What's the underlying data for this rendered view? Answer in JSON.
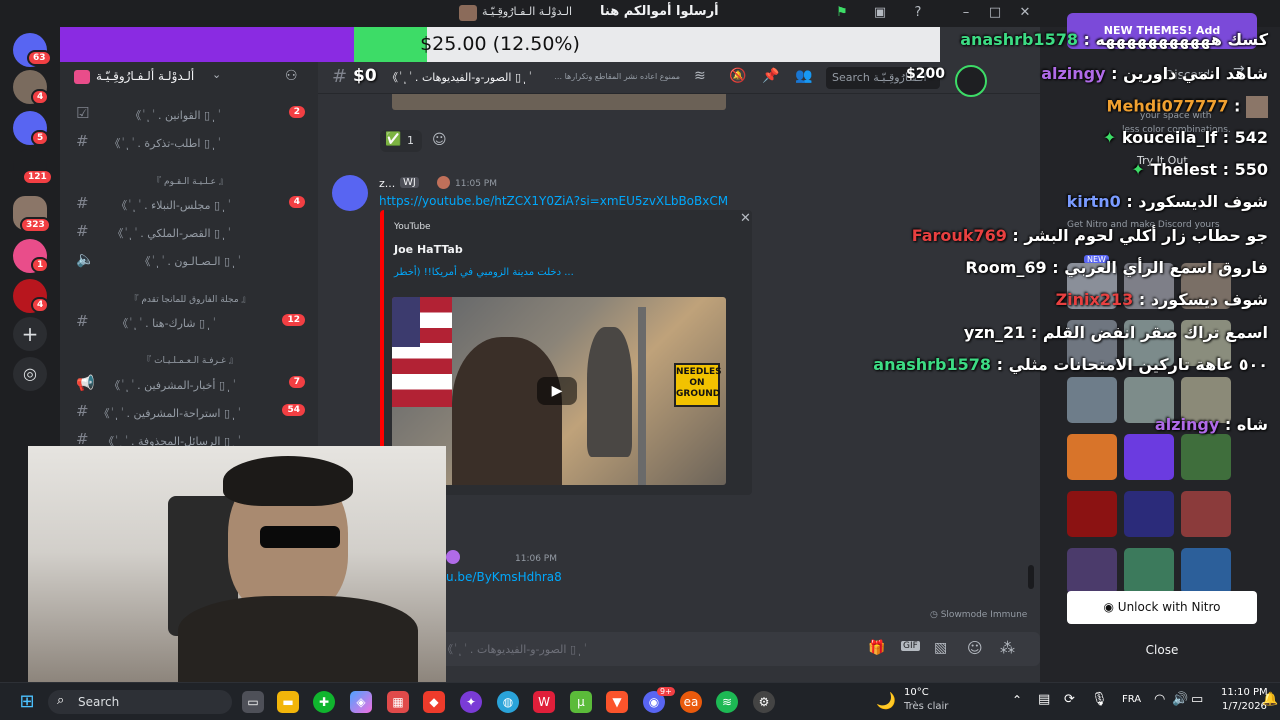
{
  "window": {
    "title": "أرسلوا أموالكم هنا",
    "server_name": "الـدوْلـة الـفـارُوقِـيّـة"
  },
  "goal_bar": {
    "text": "$25.00 (12.50%)",
    "progress_percent": 12.5,
    "left_amount": "$0",
    "right_amount": "$200"
  },
  "rail": {
    "badges": [
      "63",
      "4",
      "5",
      "121",
      "323",
      "1",
      "4"
    ]
  },
  "sidebar": {
    "server_title": "ألـدوْلـة ألـفـارُوقِـيّـة",
    "channels": [
      {
        "label": "《 ٰ ٖ ٰ . القوانين ▯ ٖ ٰ",
        "count": "2"
      },
      {
        "label": "《 ٰ ٖ ٰ . اطلب-تذكرة ▯ ٖ ٰ",
        "count": ""
      },
      {
        "label": "《 ٰ ٖ ٰ . مجلس-النبلاء ▯ ٖ ٰ",
        "count": "4"
      },
      {
        "label": "《 ٰ ٖ ٰ . القصر-الملكي ▯ ٖ ٰ",
        "count": ""
      },
      {
        "label": "《 ٰ ٖ ٰ . الـصـالـون ▯ ٖ ٰ",
        "count": ""
      },
      {
        "label": "《 ٰ ٖ ٰ . شارك-هنا ▯ ٖ ٰ",
        "count": "12"
      },
      {
        "label": "《 ٰ ٖ ٰ . أخبار-المشرفين ▯ ٖ ٰ",
        "count": "7"
      },
      {
        "label": "《 ٰ ٖ ٰ . استراحة-المشرفين ▯ ٖ ٰ",
        "count": "54"
      },
      {
        "label": "《 ٰ ٖ ٰ . الرسائل-المحذوفة ▯ ٖ ٰ",
        "count": ""
      }
    ],
    "categories": [
      "『 عـلـيـة الـقـوم 』",
      "『 مجلة الفاروق للمانجا تقدم 』",
      "『 غـرفـة الـعـمـلـيـات 』"
    ]
  },
  "header": {
    "channel_name": "《 ٰ ٖ ٰ . الصور-و-الفيديوهات ▯ ٖ ٰ",
    "topic": "ممنوع اعاده نشر المقاطع وتكرارها ...",
    "search_placeholder": "Search الـفـارُوقِـيّـة"
  },
  "messages": {
    "reaction_count": "1",
    "author": "z...",
    "author_tag": "WJ",
    "time": "11:05 PM",
    "link": "https://youtube.be/htZCX1Y0ZiA?si=xmEU5zvXLbBoBxCM",
    "embed_provider": "YouTube",
    "embed_author": "Joe HaTTab",
    "embed_title": "دخلت مدينة الزومبي في أمريكا!! (أخطر ...",
    "sign_text": "NEEDLES ON GROUND",
    "second_time": "11:06 PM",
    "second_link": "u.be/ByKmsHdhra8",
    "slowmode": "Slowmode Immune"
  },
  "input": {
    "placeholder": "《 ٰ ٖ ٰ . الصور-و-الفيديوهات ▯ ٖ ٰ"
  },
  "overlay_chat": [
    {
      "user": "anashrb1578",
      "text": "كسك هههههههههههه",
      "color": "#3ddc84"
    },
    {
      "user": "alzingy",
      "text": "شاهد انمي داورين",
      "color": "#b06be8"
    },
    {
      "user": "Mehdi077777",
      "text": "",
      "color": "#f0a030"
    },
    {
      "user": "kouceila_lf",
      "text": "542",
      "color": "#ffffff",
      "diamond": true
    },
    {
      "user": "Thelest",
      "text": "550",
      "color": "#ffffff",
      "diamond": true
    },
    {
      "user": "kirtn0",
      "text": "شوف الديسكورد",
      "color": "#7a9bff"
    },
    {
      "user": "Farouk769",
      "text": "جو حطاب زار أكلي لحوم البشر",
      "color": "#e84040"
    },
    {
      "user": "Room_69",
      "text": "فاروق اسمع الرأي العربي",
      "color": "#ffffff"
    },
    {
      "user": "Zinix213",
      "text": "شوف ديسكورد",
      "color": "#e84040"
    },
    {
      "user": "yzn_21",
      "text": "اسمع تراك صقر انفض القلم",
      "color": "#ffffff"
    },
    {
      "user": "anashrb1578",
      "text": "٥٠٠ عاهة تاركين الامتحانات مثلي",
      "color": "#3ddc84"
    },
    {
      "user": "alzingy",
      "text": "شاه",
      "color": "#b06be8"
    }
  ],
  "theme_panel": {
    "banner": "NEW THEMES! Add",
    "discord_label": "Discord",
    "tagline": "your space with",
    "tagline2": "less color combinations.",
    "try_it": "Try It Out",
    "desc": "Get Nitro and make Discord yours",
    "new_tag": "NEW",
    "unlock": "Unlock with Nitro",
    "close": "Close",
    "swatches": [
      "#8a8f99",
      "#7e7f88",
      "#7a6f66",
      "#6f7680",
      "#7c8b8b",
      "#8a8d7d",
      "#6e7d8a",
      "#7d8c8a",
      "#8b8a78",
      "#d8742a",
      "#6b3be0",
      "#3f6e3c",
      "#8b1212",
      "#2b2b7a",
      "#8b3b3b",
      "#4b3b6b",
      "#3c7a5c",
      "#2c5f9a"
    ]
  },
  "taskbar": {
    "search": "Search",
    "weather_temp": "10°C",
    "weather_desc": "Très clair",
    "lang": "FRA",
    "time": "11:10 PM",
    "date": "1/7/2026",
    "discord_badge": "9+"
  }
}
